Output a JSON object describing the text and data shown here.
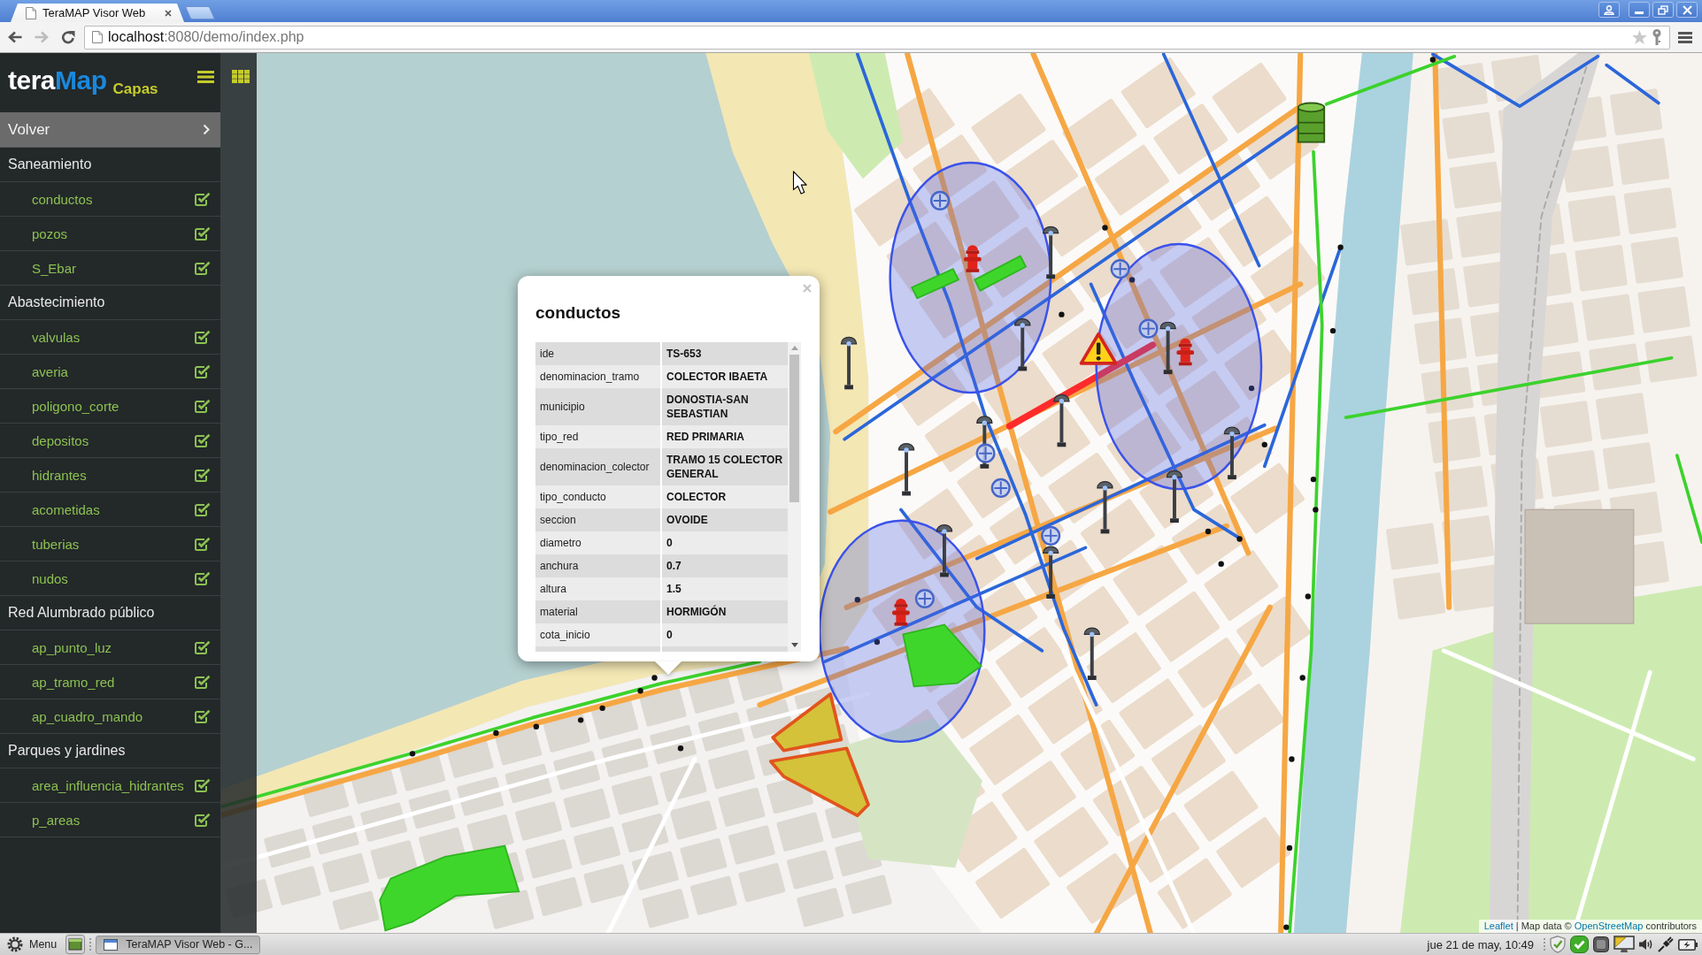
{
  "browser": {
    "tab": {
      "title": "TeraMAP Visor Web"
    },
    "nav": [
      {
        "kind": "back",
        "disabled": false
      },
      {
        "kind": "forward",
        "disabled": true
      },
      {
        "kind": "reload",
        "disabled": false
      }
    ],
    "address": {
      "host": "localhost",
      "path": ":8080/demo/index.php"
    }
  },
  "sidebar": {
    "logo": [
      "tera",
      "Map"
    ],
    "title": "Capas",
    "back": {
      "label": "Volver"
    },
    "groups": [
      {
        "label": "Saneamiento",
        "layers": [
          {
            "label": "conductos",
            "checked": true
          },
          {
            "label": "pozos",
            "checked": true
          },
          {
            "label": "S_Ebar",
            "checked": true
          }
        ]
      },
      {
        "label": "Abastecimiento",
        "layers": [
          {
            "label": "valvulas",
            "checked": true
          },
          {
            "label": "averia",
            "checked": true
          },
          {
            "label": "poligono_corte",
            "checked": true
          },
          {
            "label": "depositos",
            "checked": true
          },
          {
            "label": "hidrantes",
            "checked": true
          },
          {
            "label": "acometidas",
            "checked": true
          },
          {
            "label": "tuberias",
            "checked": true
          },
          {
            "label": "nudos",
            "checked": true
          }
        ]
      },
      {
        "label": "Red Alumbrado público",
        "layers": [
          {
            "label": "ap_punto_luz",
            "checked": true
          },
          {
            "label": "ap_tramo_red",
            "checked": true
          },
          {
            "label": "ap_cuadro_mando",
            "checked": true
          }
        ]
      },
      {
        "label": "Parques y jardines",
        "layers": [
          {
            "label": "area_influencia_hidrantes",
            "checked": true
          },
          {
            "label": "p_areas",
            "checked": true
          }
        ]
      }
    ]
  },
  "map": {
    "popup": {
      "title": "conductos",
      "rows": [
        {
          "key": "ide",
          "value": "TS-653"
        },
        {
          "key": "denominacion_tramo",
          "value": "COLECTOR IBAETA"
        },
        {
          "key": "municipio",
          "value": "DONOSTIA-SAN SEBASTIAN"
        },
        {
          "key": "tipo_red",
          "value": "RED PRIMARIA"
        },
        {
          "key": "denominacion_colector",
          "value": "TRAMO 15 COLECTOR GENERAL"
        },
        {
          "key": "tipo_conducto",
          "value": "COLECTOR"
        },
        {
          "key": "seccion",
          "value": "OVOIDE"
        },
        {
          "key": "diametro",
          "value": "0"
        },
        {
          "key": "anchura",
          "value": "0.7"
        },
        {
          "key": "altura",
          "value": "1.5"
        },
        {
          "key": "material",
          "value": "HORMIGÓN"
        },
        {
          "key": "cota_inicio",
          "value": "0"
        }
      ]
    },
    "attribution": [
      {
        "kind": "link",
        "text": "Leaflet"
      },
      {
        "kind": "text",
        "text": "| Map data ©"
      },
      {
        "kind": "link",
        "text": "OpenStreetMap"
      },
      {
        "kind": "text",
        "text": "contributors"
      }
    ]
  },
  "taskbar": {
    "menu": "Menu",
    "windows": [
      {
        "label": "TeraMAP Visor Web - G...",
        "selected": true
      }
    ],
    "clock": "jue 21 de may, 10:49"
  }
}
